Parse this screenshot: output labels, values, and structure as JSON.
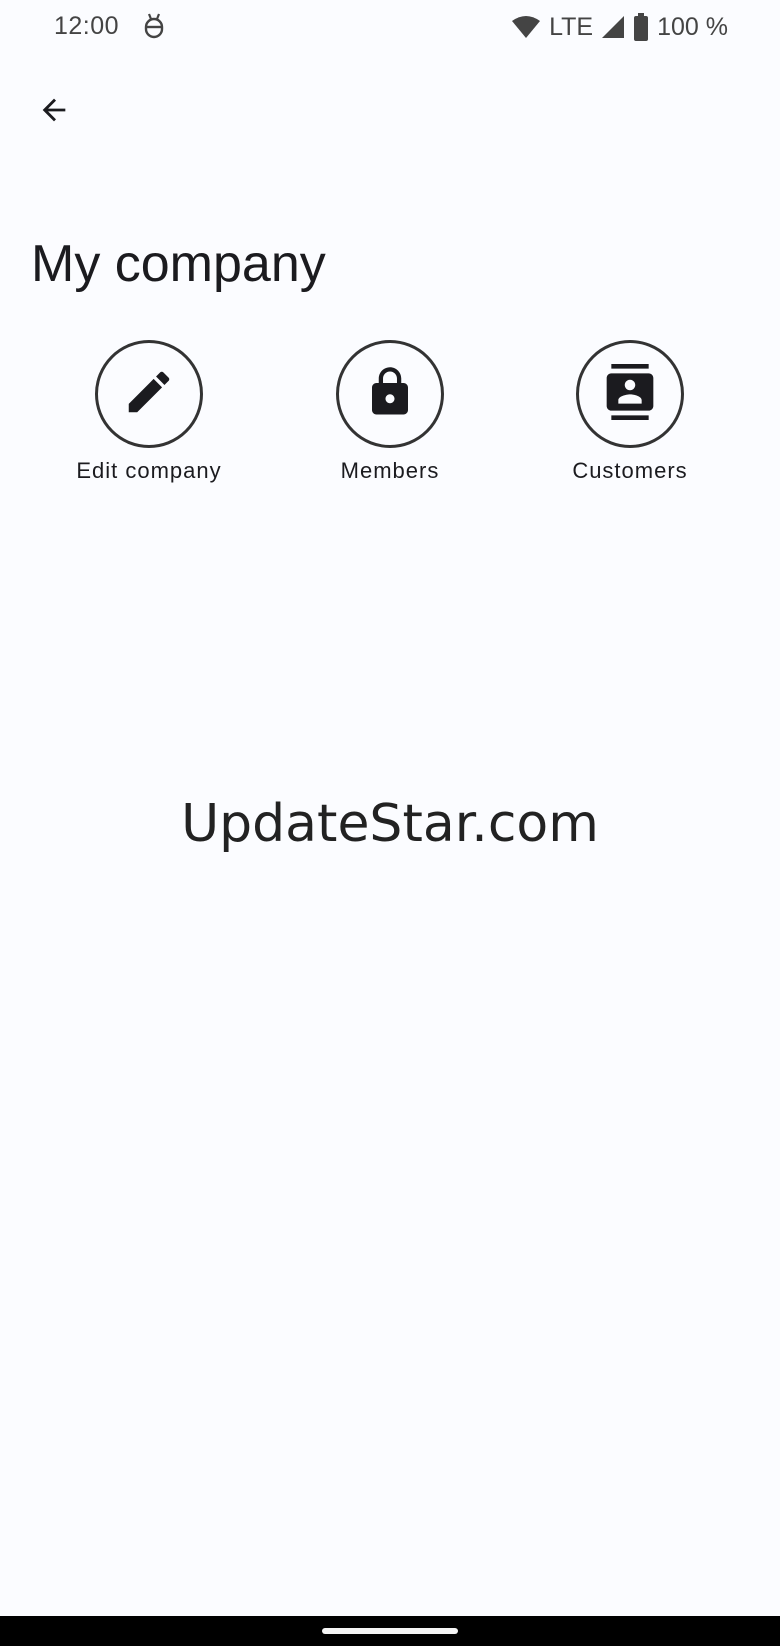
{
  "status_bar": {
    "time": "12:00",
    "network": "LTE",
    "battery": "100 %"
  },
  "header": {
    "back_icon": "arrow-left-icon",
    "title": "My company"
  },
  "actions": [
    {
      "label": "Edit company",
      "icon": "pencil-icon"
    },
    {
      "label": "Members",
      "icon": "lock-icon"
    },
    {
      "label": "Customers",
      "icon": "contacts-icon"
    }
  ],
  "watermark": "UpdateStar.com",
  "colors": {
    "background": "#fbfcff",
    "text": "#1b1b1f",
    "icon": "#1b1b1f",
    "outline": "#333333",
    "nav_bar": "#000000"
  }
}
